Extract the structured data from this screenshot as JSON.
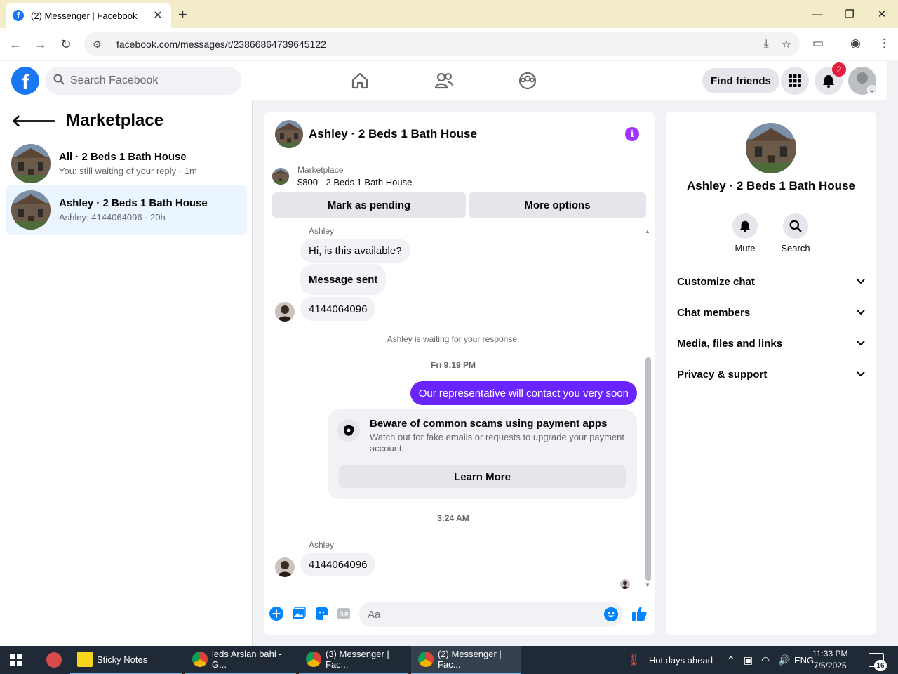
{
  "browser": {
    "tab_title": "(2) Messenger | Facebook",
    "url": "facebook.com/messages/t/23866864739645122"
  },
  "header": {
    "search_placeholder": "Search Facebook",
    "find_friends": "Find friends",
    "notification_count": "2"
  },
  "left": {
    "title": "Marketplace",
    "conversations": [
      {
        "name": "All · 2 Beds 1 Bath House",
        "sub": "You: still waiting of your reply · 1m"
      },
      {
        "name": "Ashley · 2 Beds 1 Bath House",
        "sub": "Ashley: 4144064096 · 20h"
      }
    ]
  },
  "chat": {
    "title": "Ashley · 2 Beds 1 Bath House",
    "marketplace_label": "Marketplace",
    "listing": "$800 - 2 Beds 1 Bath House",
    "mark_pending": "Mark as pending",
    "more_options": "More options",
    "messages": {
      "sender1": "Ashley",
      "m1": "Hi, is this available?",
      "m2": "Message sent",
      "m3": "4144064096",
      "waiting_note": "Ashley is waiting for your response.",
      "time1": "Fri 9:19 PM",
      "out1": "Our representative will contact you very soon",
      "scam_title": "Beware of common scams using payment apps",
      "scam_body": "Watch out for fake emails or requests to upgrade your payment account.",
      "learn_more": "Learn More",
      "time2": "3:24 AM",
      "sender2": "Ashley",
      "m4": "4144064096"
    },
    "composer_placeholder": "Aa"
  },
  "right": {
    "name": "Ashley · 2 Beds 1 Bath House",
    "mute": "Mute",
    "search": "Search",
    "sections": [
      "Customize chat",
      "Chat members",
      "Media, files and links",
      "Privacy & support"
    ]
  },
  "taskbar": {
    "items": [
      "Sticky Notes",
      "leds Arslan bahi - G...",
      "(3) Messenger | Fac...",
      "(2) Messenger | Fac..."
    ],
    "weather": "Hot days ahead",
    "lang": "ENG",
    "time": "11:33 PM",
    "date": "7/5/2025",
    "notif_count": "16"
  },
  "colors": {
    "fb_blue": "#1877f2",
    "outgoing_bubble": "#6a24fe",
    "active_conv": "#ebf5ff"
  }
}
